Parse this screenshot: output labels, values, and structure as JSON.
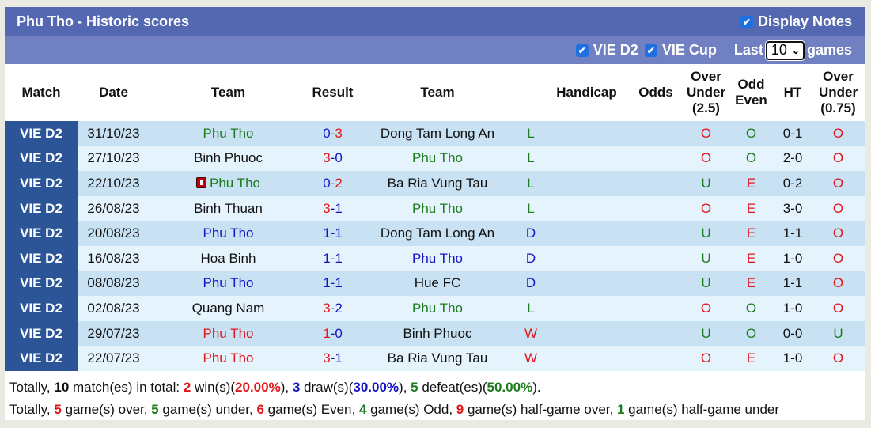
{
  "header": {
    "title": "Phu Tho - Historic scores",
    "display_notes_label": "Display Notes",
    "display_notes_checked": true
  },
  "filters": {
    "leagues": [
      {
        "label": "VIE D2",
        "checked": true
      },
      {
        "label": "VIE Cup",
        "checked": true
      }
    ],
    "last_label": "Last",
    "games_count": "10",
    "games_label": "games"
  },
  "columns": {
    "match": "Match",
    "date": "Date",
    "team_home": "Team",
    "result": "Result",
    "team_away": "Team",
    "wl": "",
    "handicap": "Handicap",
    "odds": "Odds",
    "ou_line1": "Over",
    "ou_line2": "Under",
    "ou_line3": "(2.5)",
    "oe_line1": "Odd",
    "oe_line2": "Even",
    "ht": "HT",
    "ou2_line1": "Over",
    "ou2_line2": "Under",
    "ou2_line3": "(0.75)"
  },
  "colors": {
    "red": "#e3161b",
    "blue": "#1414c8",
    "green": "#1e7b1e",
    "league_bg": "#2c5597",
    "title_bg": "#5468b2",
    "filter_bg": "#7080c0"
  },
  "rows": [
    {
      "league": "VIE D2",
      "date": "31/10/23",
      "home": "Phu Tho",
      "home_color": "green",
      "home_score": "0",
      "home_score_color": "blue",
      "away_score": "3",
      "away_score_color": "red",
      "away": "Dong Tam Long An",
      "away_color": "dark",
      "wl": "L",
      "wl_color": "green",
      "handicap": "",
      "odds": "",
      "ou": "O",
      "ou_color": "red",
      "oe": "O",
      "oe_color": "green",
      "ht": "0-1",
      "ou2": "O",
      "ou2_color": "red",
      "red_card": false
    },
    {
      "league": "VIE D2",
      "date": "27/10/23",
      "home": "Binh Phuoc",
      "home_color": "dark",
      "home_score": "3",
      "home_score_color": "red",
      "away_score": "0",
      "away_score_color": "blue",
      "away": "Phu Tho",
      "away_color": "green",
      "wl": "L",
      "wl_color": "green",
      "handicap": "",
      "odds": "",
      "ou": "O",
      "ou_color": "red",
      "oe": "O",
      "oe_color": "green",
      "ht": "2-0",
      "ou2": "O",
      "ou2_color": "red",
      "red_card": false
    },
    {
      "league": "VIE D2",
      "date": "22/10/23",
      "home": "Phu Tho",
      "home_color": "green",
      "home_score": "0",
      "home_score_color": "blue",
      "away_score": "2",
      "away_score_color": "red",
      "away": "Ba Ria Vung Tau",
      "away_color": "dark",
      "wl": "L",
      "wl_color": "green",
      "handicap": "",
      "odds": "",
      "ou": "U",
      "ou_color": "green",
      "oe": "E",
      "oe_color": "red",
      "ht": "0-2",
      "ou2": "O",
      "ou2_color": "red",
      "red_card": true
    },
    {
      "league": "VIE D2",
      "date": "26/08/23",
      "home": "Binh Thuan",
      "home_color": "dark",
      "home_score": "3",
      "home_score_color": "red",
      "away_score": "1",
      "away_score_color": "blue",
      "away": "Phu Tho",
      "away_color": "green",
      "wl": "L",
      "wl_color": "green",
      "handicap": "",
      "odds": "",
      "ou": "O",
      "ou_color": "red",
      "oe": "E",
      "oe_color": "red",
      "ht": "3-0",
      "ou2": "O",
      "ou2_color": "red",
      "red_card": false
    },
    {
      "league": "VIE D2",
      "date": "20/08/23",
      "home": "Phu Tho",
      "home_color": "blue",
      "home_score": "1",
      "home_score_color": "blue",
      "away_score": "1",
      "away_score_color": "blue",
      "away": "Dong Tam Long An",
      "away_color": "dark",
      "wl": "D",
      "wl_color": "blue",
      "handicap": "",
      "odds": "",
      "ou": "U",
      "ou_color": "green",
      "oe": "E",
      "oe_color": "red",
      "ht": "1-1",
      "ou2": "O",
      "ou2_color": "red",
      "red_card": false
    },
    {
      "league": "VIE D2",
      "date": "16/08/23",
      "home": "Hoa Binh",
      "home_color": "dark",
      "home_score": "1",
      "home_score_color": "blue",
      "away_score": "1",
      "away_score_color": "blue",
      "away": "Phu Tho",
      "away_color": "blue",
      "wl": "D",
      "wl_color": "blue",
      "handicap": "",
      "odds": "",
      "ou": "U",
      "ou_color": "green",
      "oe": "E",
      "oe_color": "red",
      "ht": "1-0",
      "ou2": "O",
      "ou2_color": "red",
      "red_card": false
    },
    {
      "league": "VIE D2",
      "date": "08/08/23",
      "home": "Phu Tho",
      "home_color": "blue",
      "home_score": "1",
      "home_score_color": "blue",
      "away_score": "1",
      "away_score_color": "blue",
      "away": "Hue FC",
      "away_color": "dark",
      "wl": "D",
      "wl_color": "blue",
      "handicap": "",
      "odds": "",
      "ou": "U",
      "ou_color": "green",
      "oe": "E",
      "oe_color": "red",
      "ht": "1-1",
      "ou2": "O",
      "ou2_color": "red",
      "red_card": false
    },
    {
      "league": "VIE D2",
      "date": "02/08/23",
      "home": "Quang Nam",
      "home_color": "dark",
      "home_score": "3",
      "home_score_color": "red",
      "away_score": "2",
      "away_score_color": "blue",
      "away": "Phu Tho",
      "away_color": "green",
      "wl": "L",
      "wl_color": "green",
      "handicap": "",
      "odds": "",
      "ou": "O",
      "ou_color": "red",
      "oe": "O",
      "oe_color": "green",
      "ht": "1-0",
      "ou2": "O",
      "ou2_color": "red",
      "red_card": false
    },
    {
      "league": "VIE D2",
      "date": "29/07/23",
      "home": "Phu Tho",
      "home_color": "red",
      "home_score": "1",
      "home_score_color": "red",
      "away_score": "0",
      "away_score_color": "blue",
      "away": "Binh Phuoc",
      "away_color": "dark",
      "wl": "W",
      "wl_color": "red",
      "handicap": "",
      "odds": "",
      "ou": "U",
      "ou_color": "green",
      "oe": "O",
      "oe_color": "green",
      "ht": "0-0",
      "ou2": "U",
      "ou2_color": "green",
      "red_card": false
    },
    {
      "league": "VIE D2",
      "date": "22/07/23",
      "home": "Phu Tho",
      "home_color": "red",
      "home_score": "3",
      "home_score_color": "red",
      "away_score": "1",
      "away_score_color": "blue",
      "away": "Ba Ria Vung Tau",
      "away_color": "dark",
      "wl": "W",
      "wl_color": "red",
      "handicap": "",
      "odds": "",
      "ou": "O",
      "ou_color": "red",
      "oe": "E",
      "oe_color": "red",
      "ht": "1-0",
      "ou2": "O",
      "ou2_color": "red",
      "red_card": false
    }
  ],
  "summary": {
    "line1": [
      {
        "text": "Totally, ",
        "style": "plain"
      },
      {
        "text": "10",
        "style": "bold-dark"
      },
      {
        "text": " match(es) in total: ",
        "style": "plain"
      },
      {
        "text": "2",
        "style": "bold-red"
      },
      {
        "text": " win(s)(",
        "style": "plain"
      },
      {
        "text": "20.00%",
        "style": "bold-red"
      },
      {
        "text": "), ",
        "style": "plain"
      },
      {
        "text": "3",
        "style": "bold-blue"
      },
      {
        "text": " draw(s)(",
        "style": "plain"
      },
      {
        "text": "30.00%",
        "style": "bold-blue"
      },
      {
        "text": "), ",
        "style": "plain"
      },
      {
        "text": "5",
        "style": "bold-green"
      },
      {
        "text": " defeat(es)(",
        "style": "plain"
      },
      {
        "text": "50.00%",
        "style": "bold-green"
      },
      {
        "text": ").",
        "style": "plain"
      }
    ],
    "line2": [
      {
        "text": "Totally, ",
        "style": "plain"
      },
      {
        "text": "5",
        "style": "bold-red"
      },
      {
        "text": " game(s) over, ",
        "style": "plain"
      },
      {
        "text": "5",
        "style": "bold-green"
      },
      {
        "text": " game(s) under, ",
        "style": "plain"
      },
      {
        "text": "6",
        "style": "bold-red"
      },
      {
        "text": " game(s) Even, ",
        "style": "plain"
      },
      {
        "text": "4",
        "style": "bold-green"
      },
      {
        "text": " game(s) Odd, ",
        "style": "plain"
      },
      {
        "text": "9",
        "style": "bold-red"
      },
      {
        "text": " game(s) half-game over, ",
        "style": "plain"
      },
      {
        "text": "1",
        "style": "bold-green"
      },
      {
        "text": " game(s) half-game under",
        "style": "plain"
      }
    ]
  }
}
